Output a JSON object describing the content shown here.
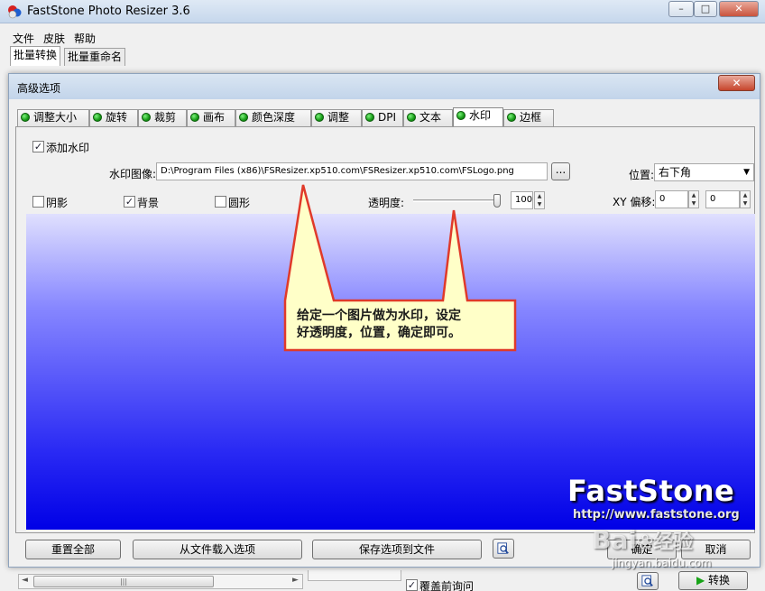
{
  "app": {
    "title": "FastStone Photo Resizer 3.6",
    "minimize": "–",
    "maximize": "□",
    "close": "✕"
  },
  "menu": [
    "文件",
    "皮肤",
    "帮助"
  ],
  "top_tabs": [
    {
      "label": "批量转换",
      "active": true
    },
    {
      "label": "批量重命名",
      "active": false
    }
  ],
  "dialog": {
    "title": "高级选项",
    "close": "✕",
    "tabs": [
      {
        "label": "调整大小",
        "active": false
      },
      {
        "label": "旋转",
        "active": false
      },
      {
        "label": "裁剪",
        "active": false
      },
      {
        "label": "画布",
        "active": false
      },
      {
        "label": "颜色深度",
        "active": false
      },
      {
        "label": "调整",
        "active": false
      },
      {
        "label": "DPI",
        "active": false
      },
      {
        "label": "文本",
        "active": false
      },
      {
        "label": "水印",
        "active": true
      },
      {
        "label": "边框",
        "active": false
      }
    ],
    "watermark": {
      "add_watermark": {
        "label": "添加水印",
        "checked": true
      },
      "image_label": "水印图像:",
      "image_path": "D:\\Program Files (x86)\\FSResizer.xp510.com\\FSResizer.xp510.com\\FSLogo.png",
      "browse_label": "...",
      "position_label": "位置:",
      "position_value": "右下角",
      "shadow": {
        "label": "阴影",
        "checked": false
      },
      "background": {
        "label": "背景",
        "checked": true
      },
      "round": {
        "label": "圆形",
        "checked": false
      },
      "opacity_label": "透明度:",
      "opacity_value": "100",
      "opacity_fraction": 1.0,
      "xy_offset_label": "XY 偏移:",
      "x_offset": "0",
      "y_offset": "0"
    },
    "preview": {
      "logo_text": "FastStone",
      "logo_url": "http://www.faststone.org"
    },
    "buttons": {
      "reset_all": "重置全部",
      "load_from_file": "从文件载入选项",
      "save_to_file": "保存选项到文件",
      "ok": "确定",
      "cancel": "取消"
    }
  },
  "callout": {
    "line1": "给定一个图片做为水印，设定",
    "line2": "好透明度，位置，确定即可。"
  },
  "bottom": {
    "overwrite": {
      "label": "覆盖前询问",
      "checked": true
    },
    "convert_label": "转换",
    "scroll_grip": "|||"
  },
  "watermark_overlay": {
    "brand": "Bai",
    "brand_mark": "经验",
    "url": "jingyan.baidu.com"
  },
  "colors": {
    "callout_bg": "#ffffc8",
    "callout_border": "#e03a2a",
    "preview_top": "#e0e0fe",
    "preview_bottom": "#0000e6"
  }
}
